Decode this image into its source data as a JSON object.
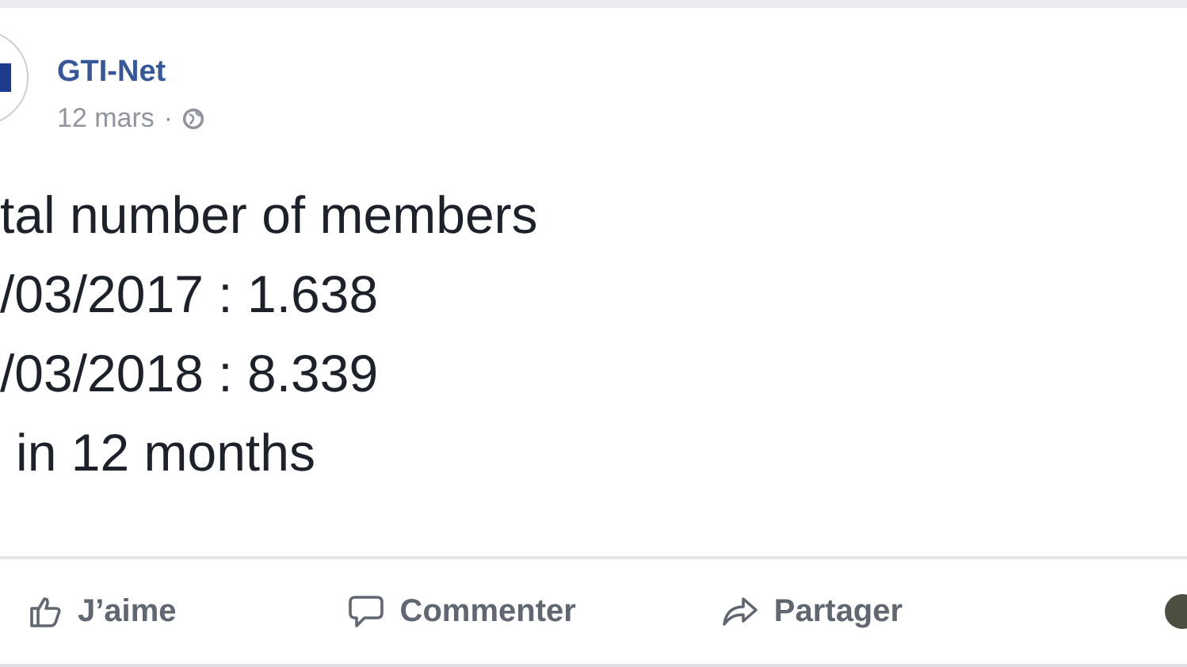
{
  "post": {
    "author": "GTI-Net",
    "date": "12 mars",
    "separator": "·",
    "lines": [
      "tal number of members",
      "/03/2017 : 1.638",
      "/03/2018 : 8.339",
      "in 12 months"
    ]
  },
  "actions": [
    {
      "kind": "like",
      "label": "J’aime"
    },
    {
      "kind": "comment",
      "label": "Commenter"
    },
    {
      "kind": "share",
      "label": "Partager"
    }
  ]
}
